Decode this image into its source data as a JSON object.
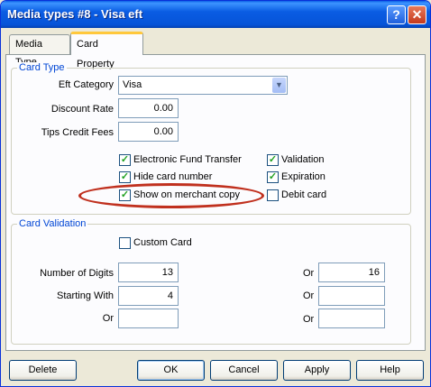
{
  "window": {
    "title": "Media types #8 - Visa eft",
    "help_btn": "?",
    "close_btn": "✕"
  },
  "tabs": [
    {
      "label": "Media Type",
      "active": false
    },
    {
      "label": "Card Property",
      "active": true
    }
  ],
  "card_type": {
    "legend": "Card Type",
    "eft_category": {
      "label": "Eft Category",
      "value": "Visa"
    },
    "discount_rate": {
      "label": "Discount Rate",
      "value": "0.00"
    },
    "tips_credit_fees": {
      "label": "Tips Credit Fees",
      "value": "0.00"
    },
    "checkboxes": {
      "electronic_fund_transfer": {
        "label": "Electronic Fund Transfer",
        "checked": true
      },
      "hide_card_number": {
        "label": "Hide card number",
        "checked": true
      },
      "show_on_merchant_copy": {
        "label": "Show on merchant copy",
        "checked": true
      },
      "validation": {
        "label": "Validation",
        "checked": true
      },
      "expiration": {
        "label": "Expiration",
        "checked": true
      },
      "debit_card": {
        "label": "Debit card",
        "checked": false
      }
    }
  },
  "card_validation": {
    "legend": "Card Validation",
    "custom_card": {
      "label": "Custom Card",
      "checked": false
    },
    "number_of_digits": {
      "label": "Number of Digits",
      "value": "13"
    },
    "starting_with": {
      "label": "Starting With",
      "value": "4"
    },
    "or_label": "Or",
    "or_digits": "16",
    "or_starting": "",
    "or_extra_left": "",
    "or_extra_right": ""
  },
  "buttons": {
    "delete": "Delete",
    "ok": "OK",
    "cancel": "Cancel",
    "apply": "Apply",
    "help": "Help"
  },
  "colors": {
    "titlebar": "#0a5ce3",
    "annotation": "#c0301e",
    "legend": "#0046d5"
  }
}
